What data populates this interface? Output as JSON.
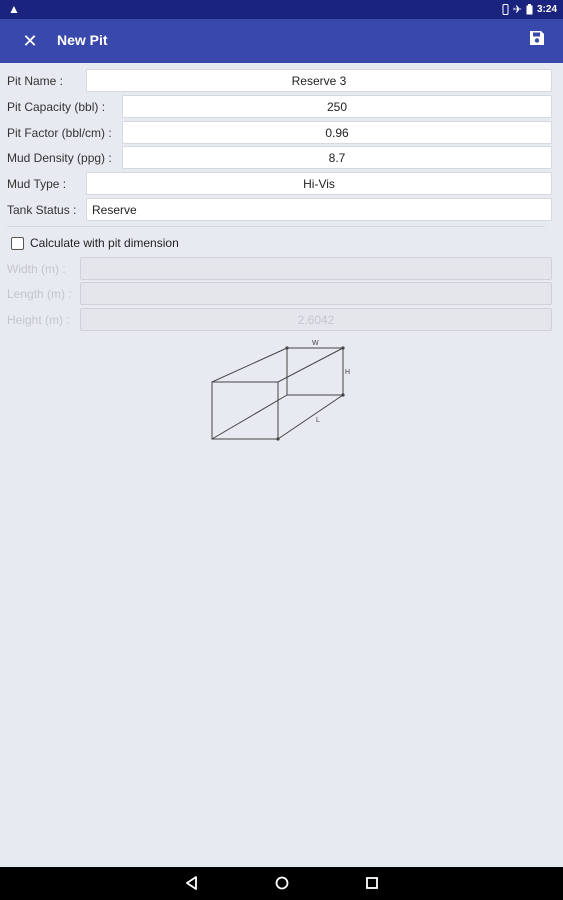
{
  "status_bar": {
    "time": "3:24"
  },
  "app_bar": {
    "title": "New Pit"
  },
  "form": {
    "pit_name": {
      "label": "Pit Name :",
      "value": "Reserve 3"
    },
    "pit_capacity": {
      "label": "Pit Capacity (bbl) :",
      "value": "250"
    },
    "pit_factor": {
      "label": "Pit Factor (bbl/cm) :",
      "value": "0.96"
    },
    "mud_density": {
      "label": "Mud Density (ppg) :",
      "value": "8.7"
    },
    "mud_type": {
      "label": "Mud Type :",
      "value": "Hi-Vis"
    },
    "tank_status": {
      "label": "Tank Status :",
      "value": "Reserve"
    }
  },
  "dimensions": {
    "checkbox_label": "Calculate with pit dimension",
    "checked": false,
    "width": {
      "label": "Width (m) :",
      "value": ""
    },
    "length": {
      "label": "Length (m) :",
      "value": ""
    },
    "height": {
      "label": "Height (m) :",
      "value": "2.6042"
    }
  },
  "diagram": {
    "w_label": "W",
    "h_label": "H",
    "l_label": "L"
  },
  "colors": {
    "status_bar": "#1a237e",
    "app_bar": "#3949ab",
    "background": "#e8eaf1"
  }
}
